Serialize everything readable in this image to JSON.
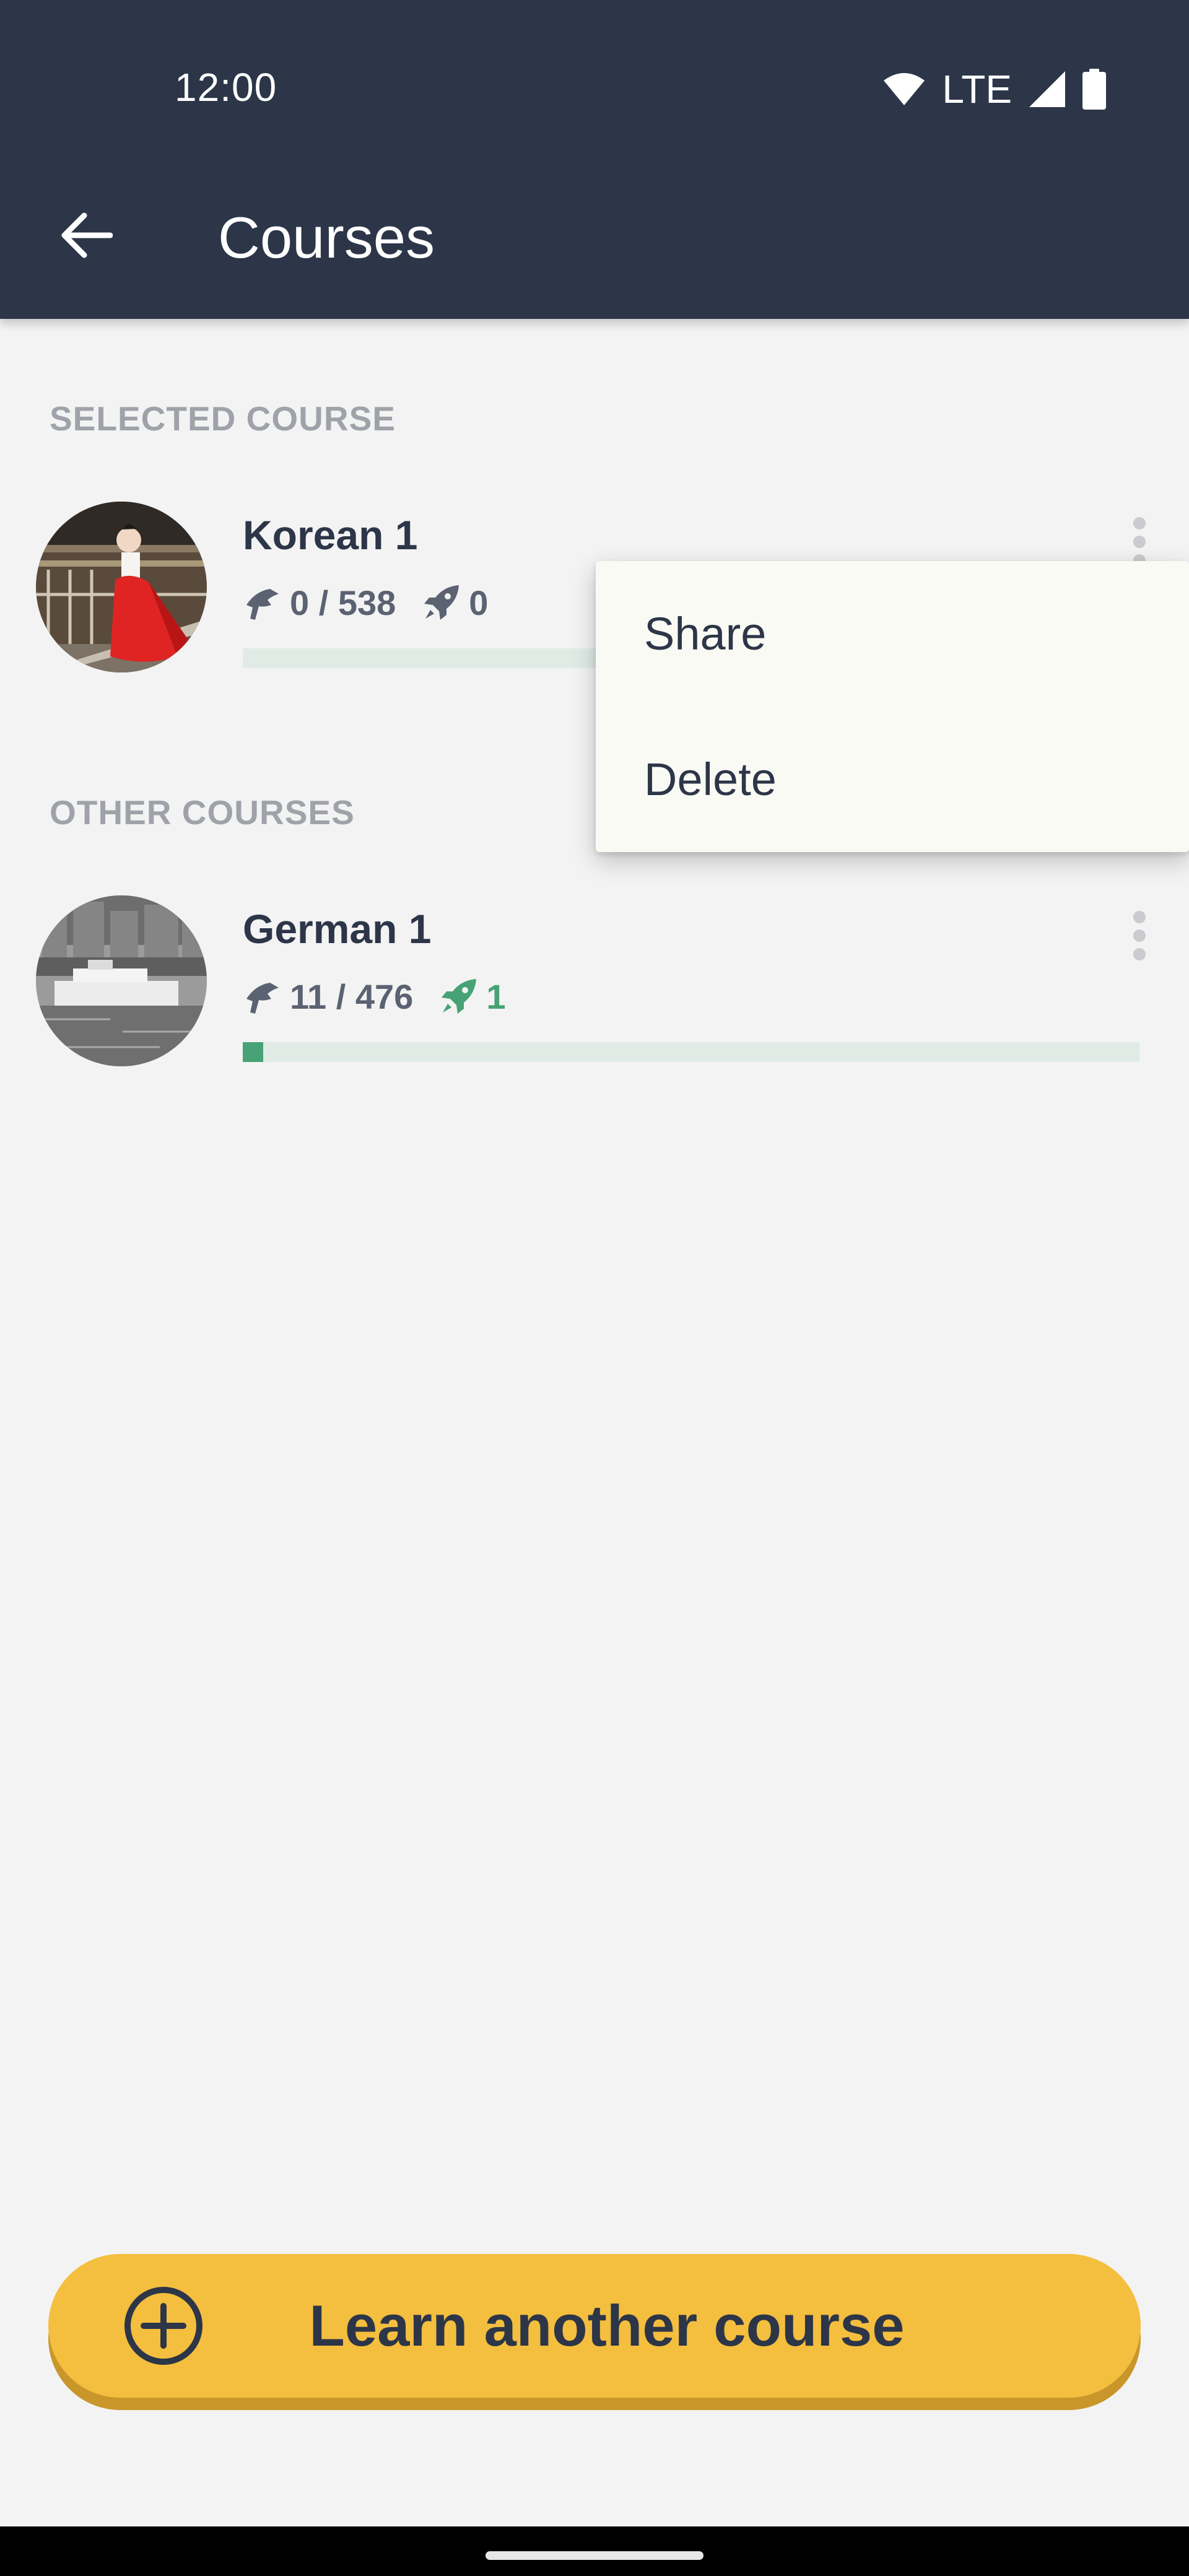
{
  "status_bar": {
    "time": "12:00",
    "network": "LTE",
    "icons": [
      "wifi-icon",
      "signal-icon",
      "battery-icon"
    ]
  },
  "app_bar": {
    "back_icon": "arrow-left-icon",
    "title": "Courses"
  },
  "selected_section": {
    "header": "SELECTED COURSE",
    "course": {
      "name": "Korean 1",
      "learned": "0 / 538",
      "review": "0",
      "progress": 0,
      "review_color": "#5b6271"
    }
  },
  "other_section": {
    "header": "OTHER COURSES",
    "courses": [
      {
        "name": "German 1",
        "learned": "11 / 476",
        "review": "1",
        "progress": 0.023,
        "review_color": "#47a275"
      }
    ]
  },
  "popup_menu": {
    "items": [
      {
        "label": "Share"
      },
      {
        "label": "Delete"
      }
    ]
  },
  "learn_button": {
    "label": "Learn another course",
    "icon": "plus-circle-icon"
  },
  "colors": {
    "app_bar": "#2c3648",
    "background": "#f3f3f3",
    "accent_green": "#47a275",
    "button_yellow": "#f4be3e",
    "text_dark": "#2d3648"
  }
}
